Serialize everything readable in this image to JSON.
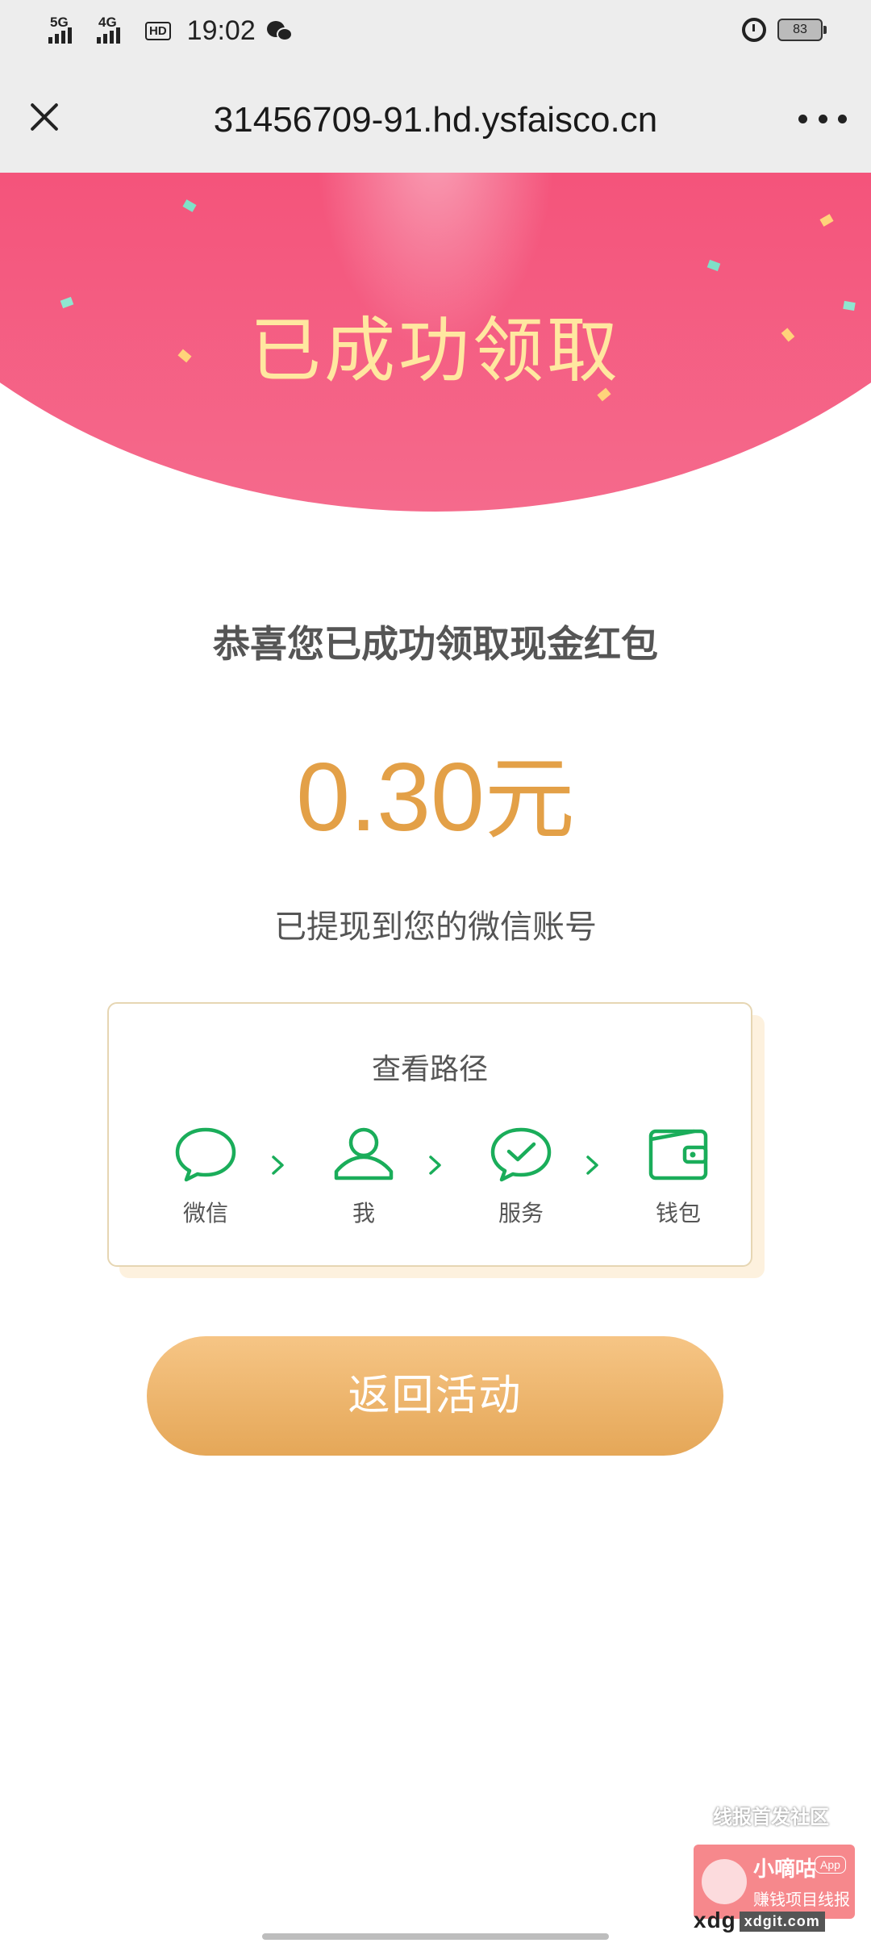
{
  "status_bar": {
    "signal_1": "5G",
    "signal_2": "4G",
    "hd_label": "HD",
    "time": "19:02",
    "battery": "83"
  },
  "nav": {
    "title": "31456709-91.hd.ysfaisco.cn"
  },
  "banner": {
    "title": "已成功领取"
  },
  "result": {
    "congrats": "恭喜您已成功领取现金红包",
    "amount_value": "0.30",
    "amount_unit": "元",
    "note": "已提现到您的微信账号"
  },
  "path_card": {
    "title": "查看路径",
    "steps": [
      {
        "label": "微信",
        "icon": "chat-bubble-icon"
      },
      {
        "label": "我",
        "icon": "person-icon"
      },
      {
        "label": "服务",
        "icon": "check-bubble-icon"
      },
      {
        "label": "钱包",
        "icon": "wallet-icon"
      }
    ],
    "arrow": "›"
  },
  "actions": {
    "back_label": "返回活动"
  },
  "watermark": {
    "top": "线报首发社区",
    "name": "小嘀咕",
    "app": "App",
    "sub": "赚钱项目线报",
    "domain": "xdg",
    "domain_small": "xdgit.com"
  },
  "colors": {
    "accent_gold": "#e3a047",
    "banner_pink": "#f7356a",
    "wechat_green": "#1aad5a"
  }
}
